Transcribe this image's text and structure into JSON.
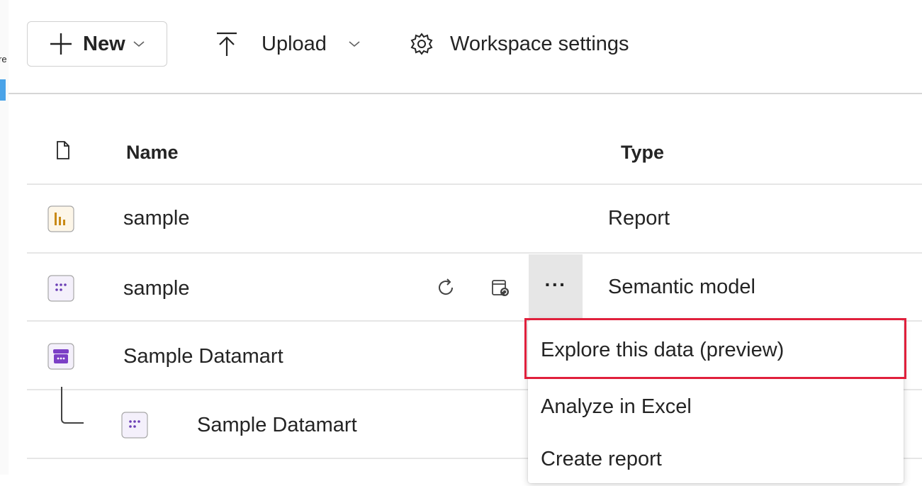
{
  "toolbar": {
    "new_label": "New",
    "upload_label": "Upload",
    "settings_label": "Workspace settings"
  },
  "table": {
    "headers": {
      "name": "Name",
      "type": "Type"
    },
    "rows": [
      {
        "name": "sample",
        "type": "Report",
        "icon": "report-icon"
      },
      {
        "name": "sample",
        "type": "Semantic model",
        "icon": "semantic-model-icon"
      },
      {
        "name": "Sample Datamart",
        "type": "",
        "icon": "datamart-icon"
      },
      {
        "name": "Sample Datamart",
        "type": "",
        "icon": "semantic-model-icon"
      }
    ]
  },
  "row_actions": {
    "more_label": "···"
  },
  "context_menu": {
    "items": [
      {
        "label": "Explore this data (preview)"
      },
      {
        "label": "Analyze in Excel"
      },
      {
        "label": "Create report"
      }
    ]
  },
  "left_fragment": {
    "text": "re"
  },
  "colors": {
    "highlight": "#e0203c",
    "report_icon": "#c98a16",
    "semantic_icon": "#6b3fb5",
    "datamart_icon": "#7b3fc6"
  }
}
